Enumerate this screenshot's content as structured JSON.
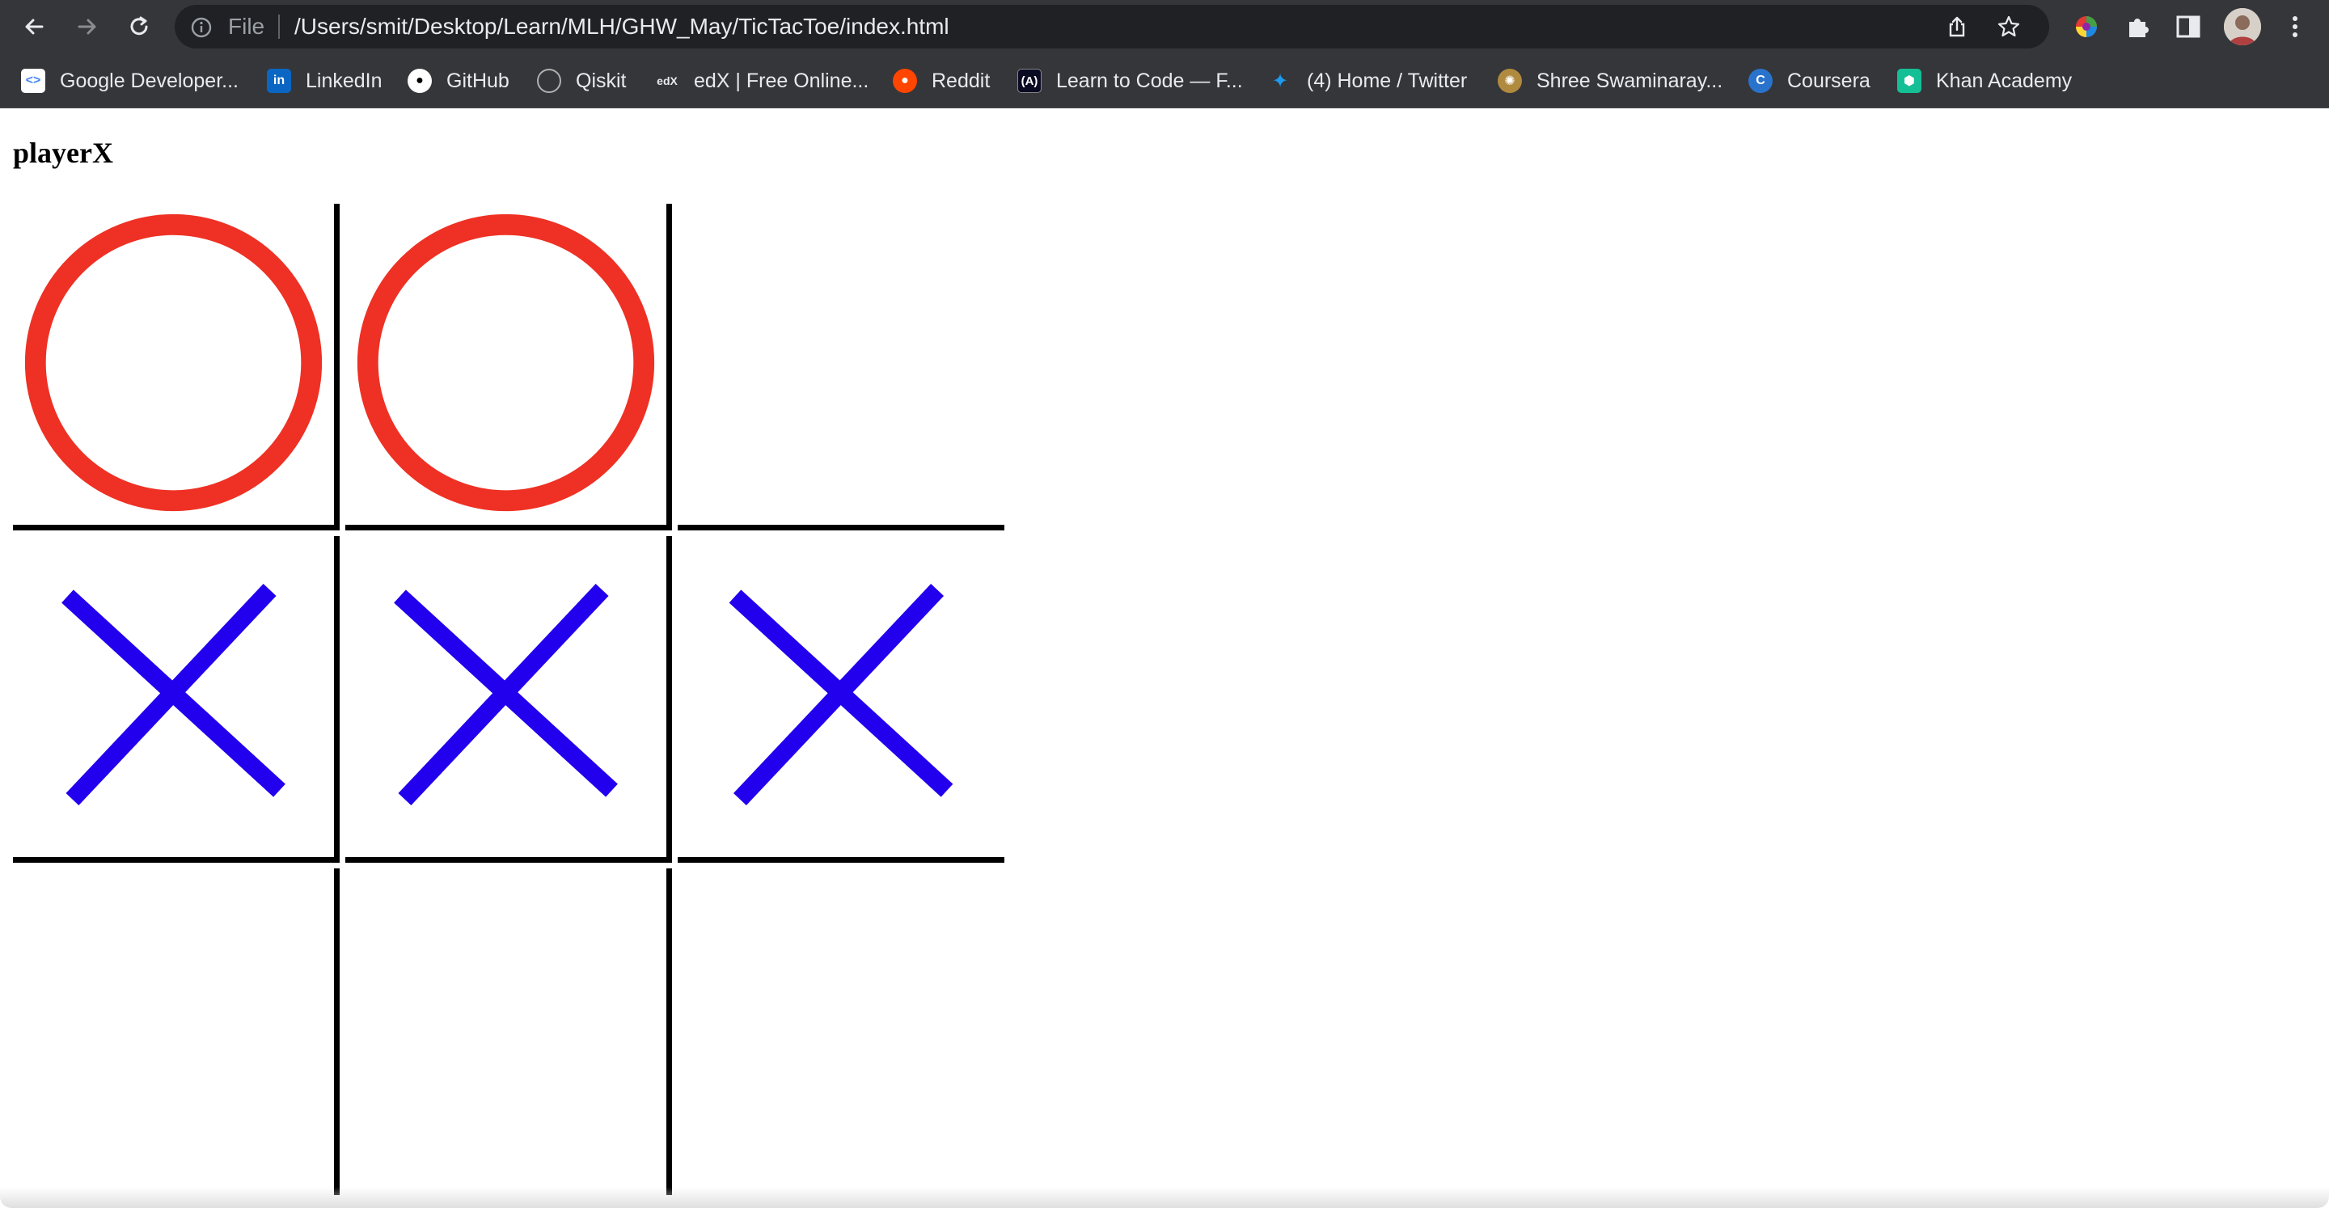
{
  "browser": {
    "scheme_label": "File",
    "url": "/Users/smit/Desktop/Learn/MLH/GHW_May/TicTacToe/index.html",
    "bookmarks": [
      {
        "label": "Google Developer...",
        "icon": "google-developers-icon",
        "color": "#ffffff"
      },
      {
        "label": "LinkedIn",
        "icon": "linkedin-icon",
        "color": "#0a66c2"
      },
      {
        "label": "GitHub",
        "icon": "github-icon",
        "color": "#ffffff"
      },
      {
        "label": "Qiskit",
        "icon": "qiskit-icon",
        "color": "#6f6f6f"
      },
      {
        "label": "edX | Free Online...",
        "icon": "edx-icon",
        "color": "#35363a"
      },
      {
        "label": "Reddit",
        "icon": "reddit-icon",
        "color": "#ff4500"
      },
      {
        "label": "Learn to Code — F...",
        "icon": "freecodecamp-icon",
        "color": "#0a0a23"
      },
      {
        "label": "(4) Home / Twitter",
        "icon": "twitter-icon",
        "color": "#1d9bf0"
      },
      {
        "label": "Shree Swaminaray...",
        "icon": "swaminarayan-icon",
        "color": "#b08a3e"
      },
      {
        "label": "Coursera",
        "icon": "coursera-icon",
        "color": "#2a73cc"
      },
      {
        "label": "Khan Academy",
        "icon": "khan-academy-icon",
        "color": "#14bf96"
      }
    ]
  },
  "game": {
    "status": "playerX",
    "board": [
      [
        "O",
        "O",
        ""
      ],
      [
        "X",
        "X",
        "X"
      ],
      [
        "",
        "",
        ""
      ]
    ],
    "colors": {
      "o": "#ee3124",
      "x": "#2200ee",
      "grid": "#000000"
    }
  }
}
